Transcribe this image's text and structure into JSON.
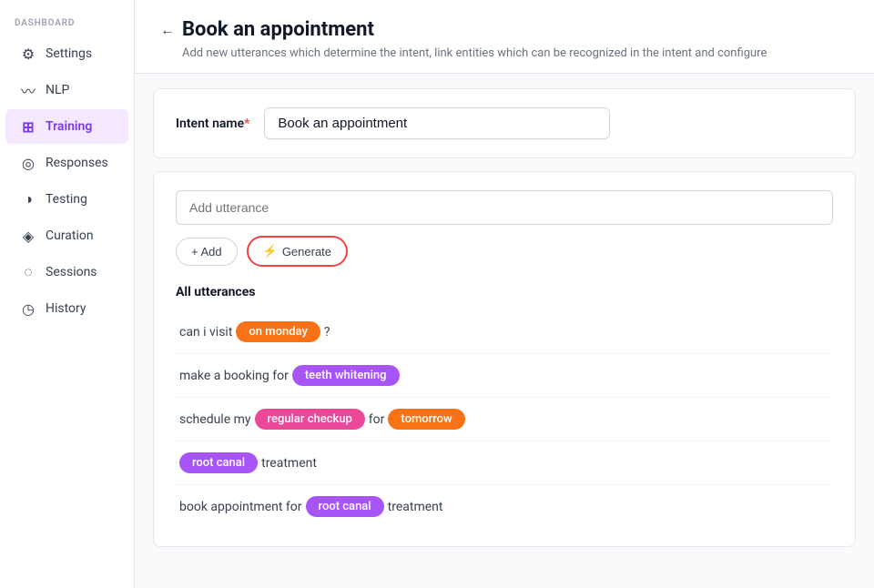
{
  "sidebar": {
    "dashboard_label": "DASHBOARD",
    "items": [
      {
        "id": "settings",
        "label": "Settings",
        "icon": "⚙",
        "active": false
      },
      {
        "id": "nlp",
        "label": "NLP",
        "icon": "〰",
        "active": false
      },
      {
        "id": "training",
        "label": "Training",
        "icon": "⊞",
        "active": true
      },
      {
        "id": "responses",
        "label": "Responses",
        "icon": "◎",
        "active": false
      },
      {
        "id": "testing",
        "label": "Testing",
        "icon": "◑",
        "active": false
      },
      {
        "id": "curation",
        "label": "Curation",
        "icon": "◈",
        "active": false
      },
      {
        "id": "sessions",
        "label": "Sessions",
        "icon": "◌",
        "active": false
      },
      {
        "id": "history",
        "label": "History",
        "icon": "◷",
        "active": false
      }
    ]
  },
  "page": {
    "back_label": "←",
    "title": "Book an appointment",
    "subtitle": "Add new utterances which determine the intent, link entities which can be recognized in the intent and configure"
  },
  "intent_section": {
    "label": "Intent name",
    "required": "*",
    "value": "Book an appointment"
  },
  "utterances_section": {
    "input_placeholder": "Add utterance",
    "add_label": "+ Add",
    "generate_label": "Generate",
    "bolt_icon": "⚡",
    "section_title": "All utterances",
    "utterances": [
      {
        "id": 1,
        "parts": [
          {
            "type": "text",
            "value": "can i visit "
          },
          {
            "type": "tag",
            "value": "on monday",
            "color": "orange"
          },
          {
            "type": "text",
            "value": " ?"
          }
        ]
      },
      {
        "id": 2,
        "parts": [
          {
            "type": "text",
            "value": "make a booking for "
          },
          {
            "type": "tag",
            "value": "teeth whitening",
            "color": "purple"
          }
        ]
      },
      {
        "id": 3,
        "parts": [
          {
            "type": "text",
            "value": "schedule my "
          },
          {
            "type": "tag",
            "value": "regular checkup",
            "color": "pink"
          },
          {
            "type": "text",
            "value": " for "
          },
          {
            "type": "tag",
            "value": "tomorrow",
            "color": "orange"
          }
        ]
      },
      {
        "id": 4,
        "parts": [
          {
            "type": "tag",
            "value": "root canal",
            "color": "purple"
          },
          {
            "type": "text",
            "value": " treatment"
          }
        ]
      },
      {
        "id": 5,
        "parts": [
          {
            "type": "text",
            "value": "book appointment for "
          },
          {
            "type": "tag",
            "value": "root canal",
            "color": "purple"
          },
          {
            "type": "text",
            "value": " treatment"
          }
        ]
      }
    ]
  }
}
